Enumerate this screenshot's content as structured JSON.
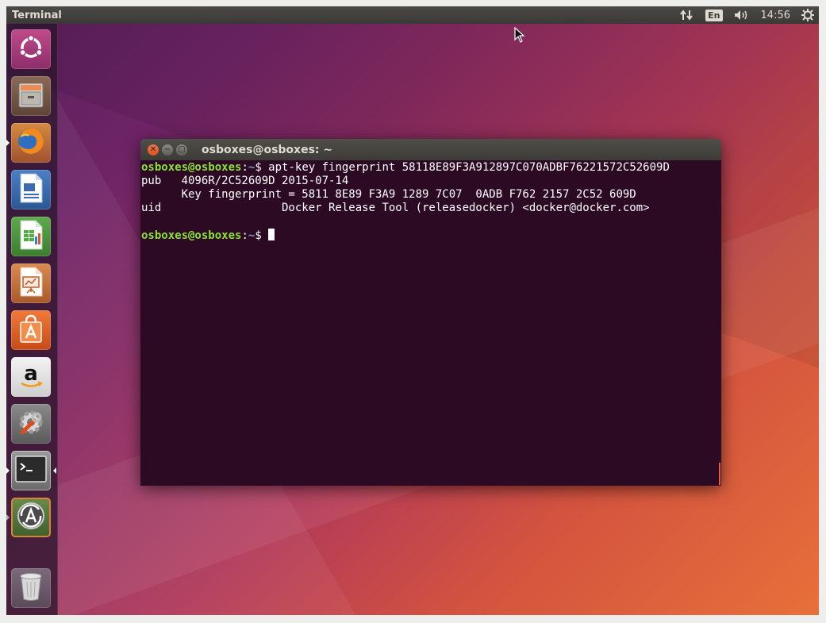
{
  "top_panel": {
    "title": "Terminal",
    "language": "En",
    "time": "14:56"
  },
  "launcher": {
    "items": [
      {
        "name": "ubuntu-dash",
        "icon": "ubuntu-logo-icon"
      },
      {
        "name": "files",
        "icon": "file-cabinet-icon"
      },
      {
        "name": "firefox",
        "icon": "firefox-icon",
        "running": true
      },
      {
        "name": "libreoffice-writer",
        "icon": "writer-document-icon"
      },
      {
        "name": "libreoffice-calc",
        "icon": "calc-spreadsheet-icon"
      },
      {
        "name": "libreoffice-impress",
        "icon": "impress-presentation-icon"
      },
      {
        "name": "ubuntu-software",
        "icon": "shopping-bag-icon"
      },
      {
        "name": "amazon",
        "icon": "amazon-icon",
        "letter": "a"
      },
      {
        "name": "system-settings",
        "icon": "settings-wrench-icon"
      },
      {
        "name": "terminal",
        "icon": "terminal-icon",
        "running": true,
        "focused": true
      },
      {
        "name": "software-updater",
        "icon": "software-updater-icon"
      },
      {
        "name": "trash",
        "icon": "trash-icon"
      }
    ]
  },
  "terminal": {
    "title": "osboxes@osboxes: ~",
    "prompt_user": "osboxes@osboxes",
    "prompt_sep": ":",
    "prompt_path": "~",
    "prompt_symbol": "$ ",
    "command": "apt-key fingerprint 58118E89F3A912897C070ADBF76221572C52609D",
    "output": [
      "pub   4096R/2C52609D 2015-07-14",
      "      Key fingerprint = 5811 8E89 F3A9 1289 7C07  0ADB F762 2157 2C52 609D",
      "uid                  Docker Release Tool (releasedocker) <docker@docker.com>",
      ""
    ]
  },
  "colors": {
    "prompt_user": "#8ae234",
    "prompt_path": "#729fcf",
    "terminal_bg": "#2c0a24",
    "accent": "#e2613b"
  }
}
